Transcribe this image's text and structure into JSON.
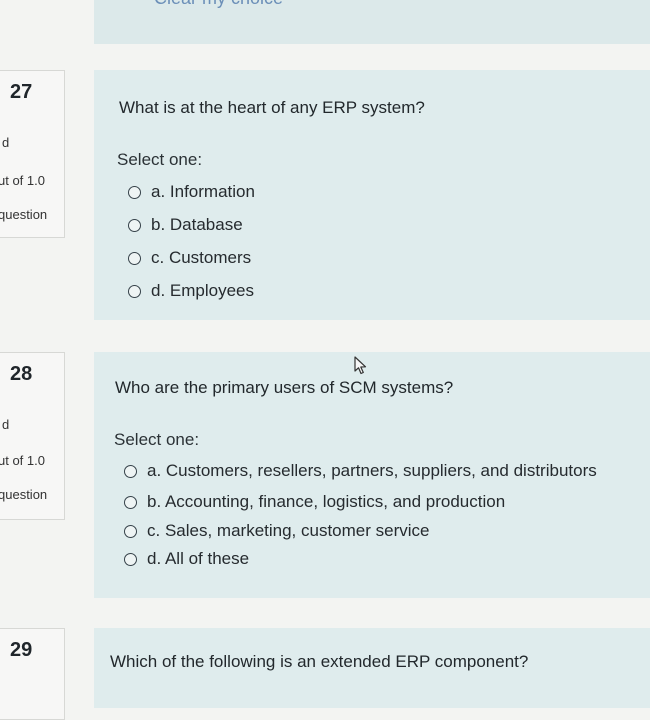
{
  "top": {
    "label": "Clear my choice"
  },
  "questions": [
    {
      "number": "27",
      "status": "d",
      "mark": "ut of 1.0",
      "flag": "question",
      "text": "What is at the heart of any ERP system?",
      "prompt": "Select one:",
      "options": [
        "a. Information",
        "b. Database",
        "c. Customers",
        "d. Employees"
      ]
    },
    {
      "number": "28",
      "status": "d",
      "mark": "ut of 1.0",
      "flag": "question",
      "text": "Who are the primary users of SCM systems?",
      "prompt": "Select one:",
      "options": [
        "a. Customers, resellers, partners, suppliers, and distributors",
        "b. Accounting, finance, logistics, and production",
        "c. Sales, marketing, customer service",
        "d. All of these"
      ]
    },
    {
      "number": "29",
      "text": "Which of the following is an extended ERP component?"
    }
  ]
}
